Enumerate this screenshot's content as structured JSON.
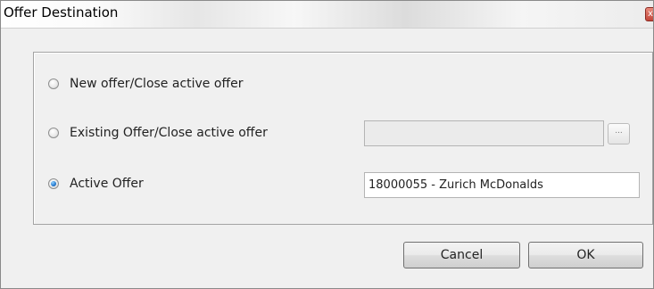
{
  "window": {
    "title": "Offer Destination",
    "close_label": "x"
  },
  "options": [
    {
      "label": "New offer/Close active offer",
      "selected": false
    },
    {
      "label": "Existing Offer/Close active offer",
      "selected": false
    },
    {
      "label": "Active Offer",
      "selected": true
    }
  ],
  "existing_offer": {
    "value": "",
    "browse_label": "..."
  },
  "active_offer": {
    "value": "18000055 - Zurich McDonalds"
  },
  "buttons": {
    "cancel_label": "Cancel",
    "ok_label": "OK"
  },
  "colors": {
    "selected_radio": "#2a7fd3",
    "close_button": "#c2463a"
  }
}
